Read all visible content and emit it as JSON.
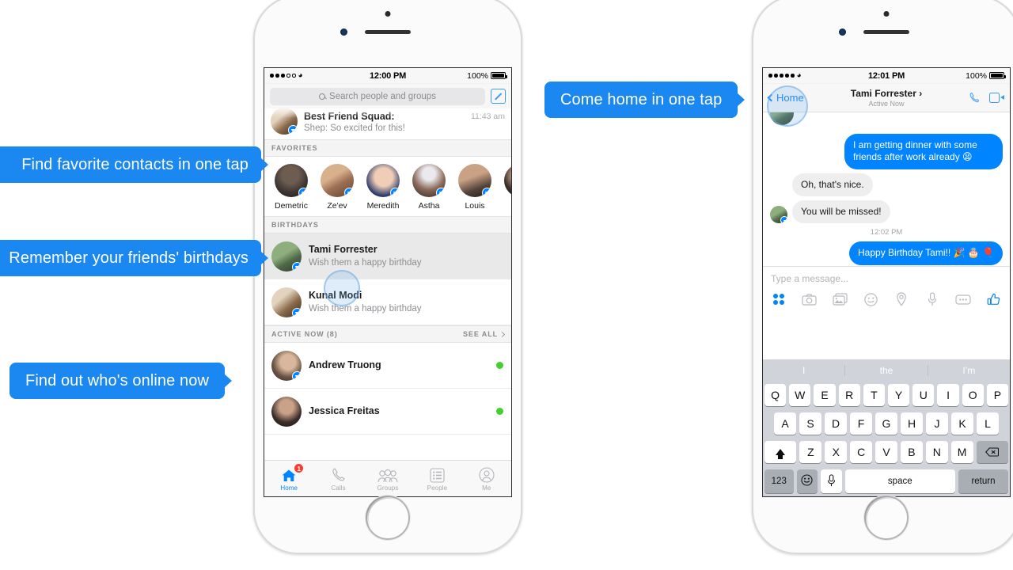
{
  "callouts": [
    {
      "id": "find-favorites",
      "text": "Find favorite contacts in one tap",
      "clipped": true
    },
    {
      "id": "remember-birthdays",
      "text": "Remember your friends' birthdays",
      "clipped": true
    },
    {
      "id": "who-is-online",
      "text": "Find out who's online now",
      "clipped": false
    },
    {
      "id": "come-home",
      "text": "Come home in one tap",
      "clipped": false
    }
  ],
  "left_phone": {
    "status_bar": {
      "time": "12:00 PM",
      "battery": "100%",
      "signal_dots": 5,
      "signal_filled": 3
    },
    "search": {
      "placeholder": "Search people and groups",
      "icon": "search-icon",
      "compose_icon": "compose-icon"
    },
    "top_conversation": {
      "title": "Best Friend Squad:",
      "preview": "Shep: So excited for this!",
      "time": "11:43 am"
    },
    "favorites": {
      "header": "FAVORITES",
      "items": [
        {
          "name": "Demetric"
        },
        {
          "name": "Ze'ev"
        },
        {
          "name": "Meredith"
        },
        {
          "name": "Astha"
        },
        {
          "name": "Louis"
        }
      ]
    },
    "birthdays": {
      "header": "BIRTHDAYS",
      "items": [
        {
          "name": "Tami Forrester",
          "sub": "Wish them a happy birthday",
          "selected": true
        },
        {
          "name": "Kunal Modi",
          "sub": "Wish them a happy birthday",
          "selected": false
        }
      ]
    },
    "active_now": {
      "header": "ACTIVE NOW (8)",
      "see_all": "SEE ALL",
      "items": [
        {
          "name": "Andrew Truong",
          "online": true
        },
        {
          "name": "Jessica Freitas",
          "online": true
        }
      ]
    },
    "tabbar": [
      {
        "label": "Home",
        "icon": "home-icon",
        "active": true,
        "badge": "1"
      },
      {
        "label": "Calls",
        "icon": "phone-icon",
        "active": false,
        "badge": ""
      },
      {
        "label": "Groups",
        "icon": "groups-icon",
        "active": false,
        "badge": ""
      },
      {
        "label": "People",
        "icon": "people-list-icon",
        "active": false,
        "badge": ""
      },
      {
        "label": "Me",
        "icon": "person-icon",
        "active": false,
        "badge": ""
      }
    ]
  },
  "right_phone": {
    "status_bar": {
      "time": "12:01 PM",
      "battery": "100%",
      "signal_dots": 5,
      "signal_filled": 5
    },
    "thread_header": {
      "back_label": "Home",
      "name": "Tami Forrester",
      "name_chevron": "›",
      "status": "Active Now",
      "call_icon": "phone-call-icon",
      "video_icon": "video-call-icon"
    },
    "messages": [
      {
        "side": "out",
        "text": "I am getting dinner with some friends after work already 😫"
      },
      {
        "side": "in",
        "text": "Oh, that's nice."
      },
      {
        "side": "in",
        "text": "You will be missed!",
        "avatar": true
      }
    ],
    "timestamp": "12:02 PM",
    "last_message": {
      "side": "out",
      "text": "Happy Birthday Tami!! 🎉 🎂 🎈",
      "delivered_icon": "delivered-check-icon"
    },
    "composer": {
      "placeholder": "Type a message...",
      "icons": [
        "apps-grid-icon",
        "camera-icon",
        "photos-icon",
        "emoji-icon",
        "location-icon",
        "microphone-icon",
        "more-icon",
        "thumbs-up-icon"
      ]
    },
    "keyboard": {
      "predictions": [
        "I",
        "the",
        "I’m"
      ],
      "row1": [
        "Q",
        "W",
        "E",
        "R",
        "T",
        "Y",
        "U",
        "I",
        "O",
        "P"
      ],
      "row2": [
        "A",
        "S",
        "D",
        "F",
        "G",
        "H",
        "J",
        "K",
        "L"
      ],
      "row3": [
        "Z",
        "X",
        "C",
        "V",
        "B",
        "N",
        "M"
      ],
      "shift_key": "shift-icon",
      "backspace_key": "backspace-icon",
      "numbers_key": "123",
      "emoji_key": "emoji-icon",
      "dictation_key": "microphone-icon",
      "space_key": "space",
      "return_key": "return"
    }
  },
  "colors": {
    "accent_blue": "#0084ff",
    "callout_blue": "#1b87f0",
    "online_green": "#43cf2e",
    "badge_red": "#fa3c2e"
  }
}
